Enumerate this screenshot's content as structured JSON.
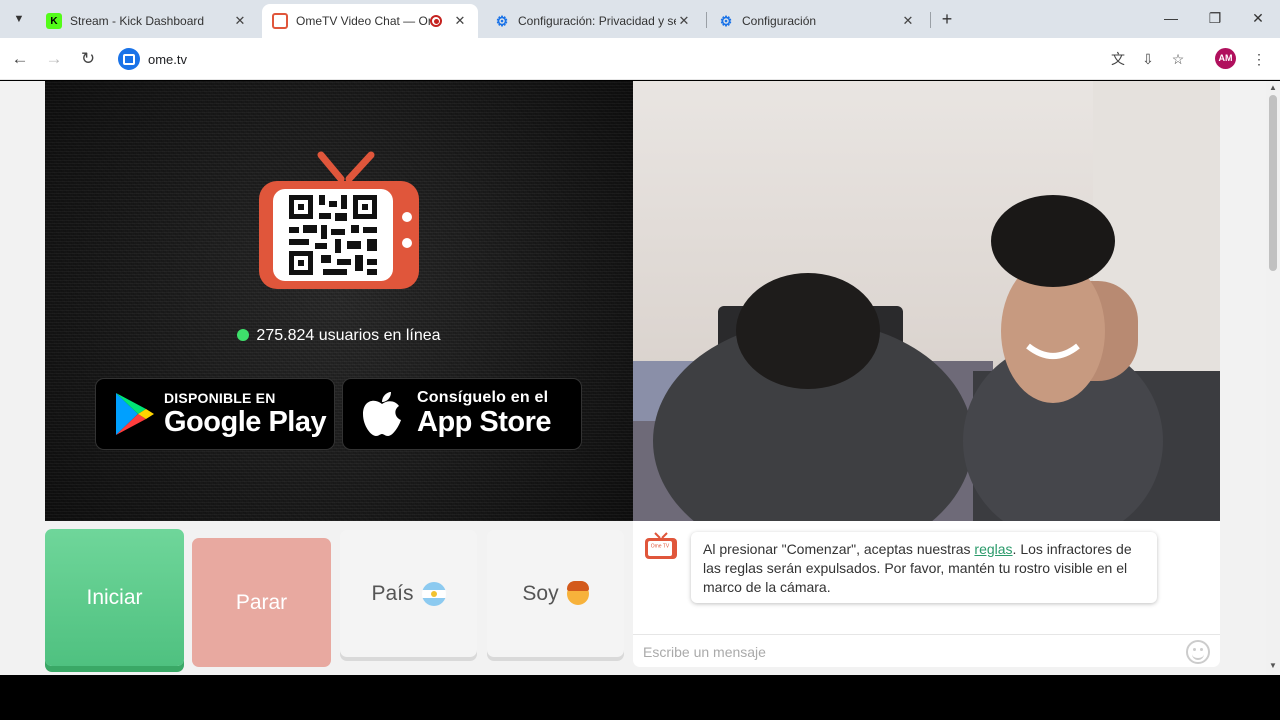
{
  "browser": {
    "tabs": [
      {
        "title": "Stream - Kick Dashboard",
        "favicon": "kick-logo-icon"
      },
      {
        "title": "OmeTV Video Chat — Ome",
        "favicon": "ometv-logo-icon",
        "recording": true
      },
      {
        "title": "Configuración: Privacidad y seg",
        "favicon": "settings-gear-icon"
      },
      {
        "title": "Configuración",
        "favicon": "settings-gear-icon"
      }
    ],
    "url": "ome.tv",
    "profile_initials": "AM"
  },
  "page": {
    "online_count": "275.824 usuarios en línea",
    "google_play": {
      "small": "DISPONIBLE EN",
      "big": "Google Play"
    },
    "app_store": {
      "small": "Consíguelo en el",
      "big": "App Store"
    },
    "buttons": {
      "start": "Iniciar",
      "stop": "Parar",
      "country": "País",
      "gender": "Soy"
    },
    "chat": {
      "logo_text": "Ome TV",
      "notice_before": "Al presionar \"Comenzar\", aceptas nuestras ",
      "notice_link": "reglas",
      "notice_after": ". Los infractores de las reglas serán expulsados. Por favor, mantén tu rostro visible en el marco de la cámara.",
      "input_placeholder": "Escribe un mensaje"
    }
  },
  "colors": {
    "accent_green": "#4fc180",
    "stop_red": "#e8a9a0",
    "tv_orange": "#e0563b",
    "online_dot": "#3ee06b"
  }
}
